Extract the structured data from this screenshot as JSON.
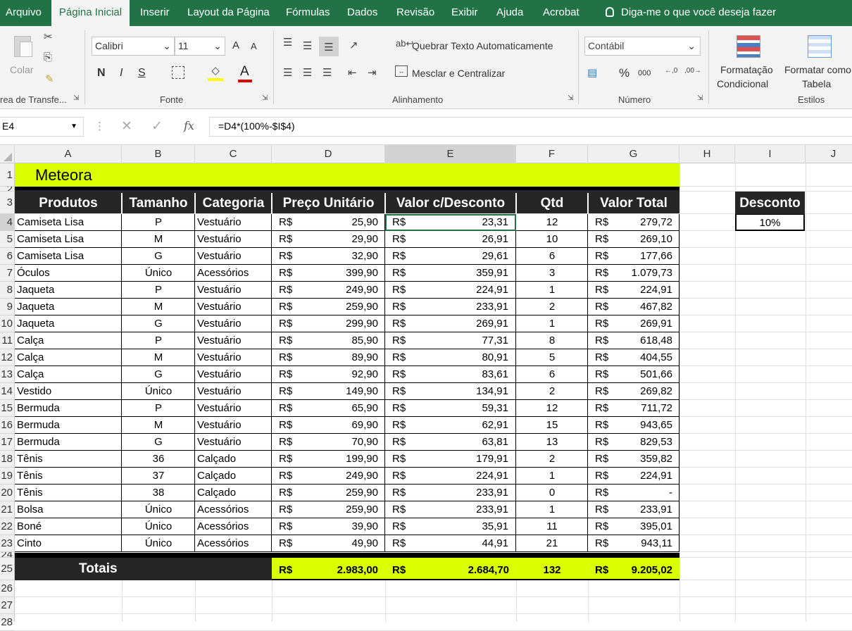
{
  "menu": {
    "tabs": [
      {
        "label": "Arquivo"
      },
      {
        "label": "Página Inicial"
      },
      {
        "label": "Inserir"
      },
      {
        "label": "Layout da Página"
      },
      {
        "label": "Fórmulas"
      },
      {
        "label": "Dados"
      },
      {
        "label": "Revisão"
      },
      {
        "label": "Exibir"
      },
      {
        "label": "Ajuda"
      },
      {
        "label": "Acrobat"
      }
    ],
    "tellme": "Diga-me o que você deseja fazer"
  },
  "ribbon": {
    "paste_label": "Colar",
    "clipboard_group": "rea de Transfe...",
    "font_name": "Calibri",
    "font_size": "11",
    "grow_label": "A",
    "shrink_label": "A",
    "bold": "N",
    "italic": "I",
    "underline": "S",
    "font_color_label": "A",
    "font_group": "Fonte",
    "wrap_text": "Quebrar Texto Automaticamente",
    "merge_center": "Mesclar e Centralizar",
    "alignment_group": "Alinhamento",
    "number_format": "Contábil",
    "percent": "%",
    "thousands": "000",
    "number_group": "Número",
    "cond_format_1": "Formatação",
    "cond_format_2": "Condicional",
    "format_table_1": "Formatar como",
    "format_table_2": "Tabela",
    "styles_group": "Estilos"
  },
  "formula_bar": {
    "name_box": "E4",
    "fx": "fx",
    "formula": "=D4*(100%-$I$4)"
  },
  "columns": [
    "A",
    "B",
    "C",
    "D",
    "E",
    "F",
    "G",
    "H",
    "I",
    "J"
  ],
  "rows": [
    "1",
    "2",
    "3",
    "4",
    "5",
    "6",
    "7",
    "8",
    "9",
    "10",
    "11",
    "12",
    "13",
    "14",
    "15",
    "16",
    "17",
    "18",
    "19",
    "20",
    "21",
    "22",
    "23",
    "24",
    "25",
    "26",
    "27",
    "28"
  ],
  "sheet": {
    "title": "Meteora",
    "headers": [
      "Produtos",
      "Tamanho",
      "Categoria",
      "Preço Unitário",
      "Valor c/Desconto",
      "Qtd",
      "Valor Total"
    ],
    "currency": "R$",
    "data": [
      [
        "Camiseta Lisa",
        "P",
        "Vestuário",
        "25,90",
        "23,31",
        "12",
        "279,72"
      ],
      [
        "Camiseta Lisa",
        "M",
        "Vestuário",
        "29,90",
        "26,91",
        "10",
        "269,10"
      ],
      [
        "Camiseta Lisa",
        "G",
        "Vestuário",
        "32,90",
        "29,61",
        "6",
        "177,66"
      ],
      [
        "Óculos",
        "Único",
        "Acessórios",
        "399,90",
        "359,91",
        "3",
        "1.079,73"
      ],
      [
        "Jaqueta",
        "P",
        "Vestuário",
        "249,90",
        "224,91",
        "1",
        "224,91"
      ],
      [
        "Jaqueta",
        "M",
        "Vestuário",
        "259,90",
        "233,91",
        "2",
        "467,82"
      ],
      [
        "Jaqueta",
        "G",
        "Vestuário",
        "299,90",
        "269,91",
        "1",
        "269,91"
      ],
      [
        "Calça",
        "P",
        "Vestuário",
        "85,90",
        "77,31",
        "8",
        "618,48"
      ],
      [
        "Calça",
        "M",
        "Vestuário",
        "89,90",
        "80,91",
        "5",
        "404,55"
      ],
      [
        "Calça",
        "G",
        "Vestuário",
        "92,90",
        "83,61",
        "6",
        "501,66"
      ],
      [
        "Vestido",
        "Único",
        "Vestuário",
        "149,90",
        "134,91",
        "2",
        "269,82"
      ],
      [
        "Bermuda",
        "P",
        "Vestuário",
        "65,90",
        "59,31",
        "12",
        "711,72"
      ],
      [
        "Bermuda",
        "M",
        "Vestuário",
        "69,90",
        "62,91",
        "15",
        "943,65"
      ],
      [
        "Bermuda",
        "G",
        "Vestuário",
        "70,90",
        "63,81",
        "13",
        "829,53"
      ],
      [
        "Tênis",
        "36",
        "Calçado",
        "199,90",
        "179,91",
        "2",
        "359,82"
      ],
      [
        "Tênis",
        "37",
        "Calçado",
        "249,90",
        "224,91",
        "1",
        "224,91"
      ],
      [
        "Tênis",
        "38",
        "Calçado",
        "259,90",
        "233,91",
        "0",
        "-"
      ],
      [
        "Bolsa",
        "Único",
        "Acessórios",
        "259,90",
        "233,91",
        "1",
        "233,91"
      ],
      [
        "Boné",
        "Único",
        "Acessórios",
        "39,90",
        "35,91",
        "11",
        "395,01"
      ],
      [
        "Cinto",
        "Único",
        "Acessórios",
        "49,90",
        "44,91",
        "21",
        "943,11"
      ]
    ],
    "totals": {
      "label": "Totais",
      "preco": "2.983,00",
      "desconto": "2.684,70",
      "qtd": "132",
      "valor": "9.205,02"
    },
    "discount_header": "Desconto",
    "discount_value": "10%"
  },
  "colors": {
    "excel_green": "#217346",
    "title_fill": "#d9ff00",
    "header_fill": "#262626"
  }
}
